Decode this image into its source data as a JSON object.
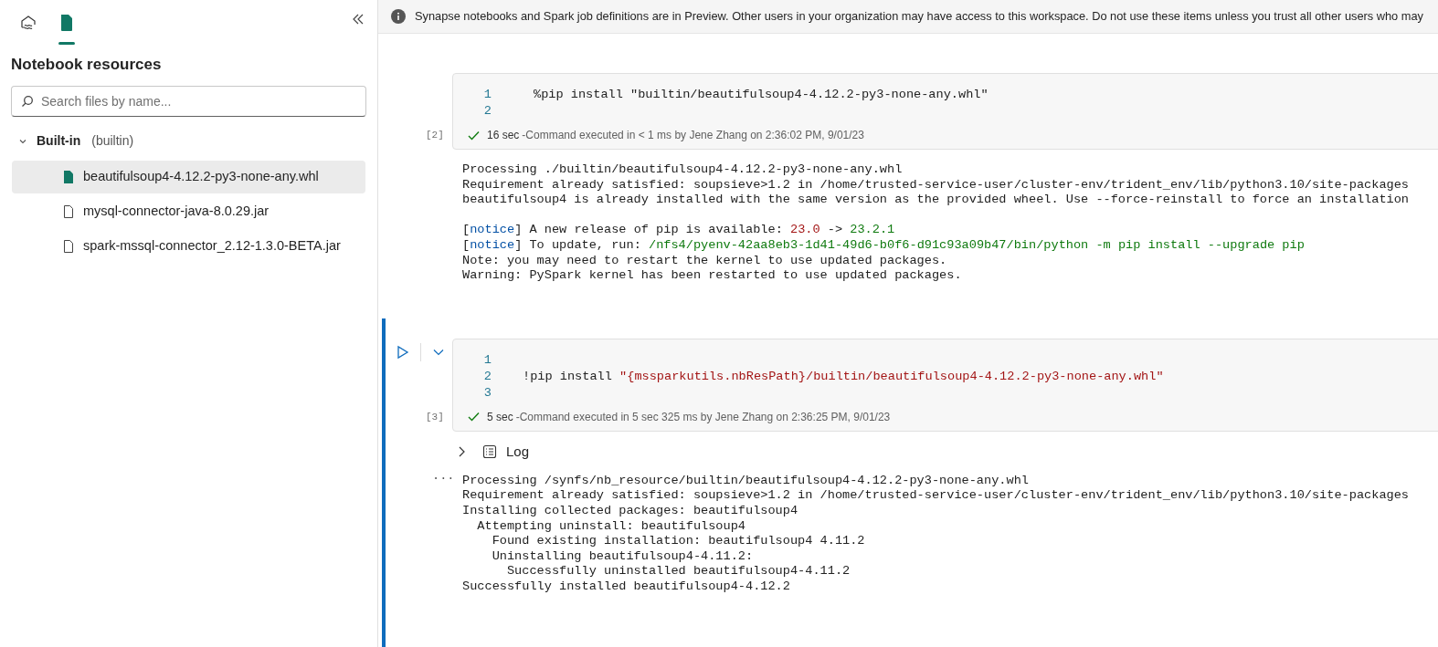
{
  "sidebar": {
    "tabs": [
      {
        "kind": "lakehouse",
        "selected": false
      },
      {
        "kind": "resources",
        "selected": true
      }
    ],
    "title": "Notebook resources",
    "search": {
      "placeholder": "Search files by name..."
    },
    "tree": [
      {
        "label": "Built-in",
        "sublabel": "(builtin)",
        "expanded": true,
        "children": [
          {
            "label": "beautifulsoup4-4.12.2-py3-none-any.whl",
            "selected": true
          },
          {
            "label": "mysql-connector-java-8.0.29.jar",
            "selected": false
          },
          {
            "label": "spark-mssql-connector_2.12-1.3.0-BETA.jar",
            "selected": false
          }
        ]
      }
    ]
  },
  "banner": {
    "text": "Synapse notebooks and Spark job definitions are in Preview. Other users in your organization may have access to this workspace. Do not use these items unless you trust all other users who may"
  },
  "cells": [
    {
      "active": false,
      "execution_count": "[2]",
      "lines": [
        {
          "number": "1",
          "segments": [
            {
              "text": "%pip install \"builtin/beautifulsoup4-4.12.2-py3-none-any.whl\"",
              "kind": "plain"
            }
          ]
        },
        {
          "number": "2"
        }
      ],
      "status": {
        "duration": "16 sec",
        "message": "-Command executed in < 1 ms by Jene Zhang on 2:36:02 PM, 9/01/23"
      },
      "output": [
        {
          "lines": [
            [
              {
                "text": "Processing ./builtin/beautifulsoup4-4.12.2-py3-none-any.whl",
                "kind": "plain"
              }
            ],
            [
              {
                "text": "Requirement already satisfied: soupsieve>1.2 in /home/trusted-service-user/cluster-env/trident_env/lib/python3.10/site-packages",
                "kind": "plain"
              }
            ],
            [
              {
                "text": "beautifulsoup4 is already installed with the same version as the provided wheel. Use --force-reinstall to force an installation",
                "kind": "plain"
              }
            ]
          ]
        },
        {
          "lines": [
            [
              {
                "text": "[",
                "kind": "plain"
              },
              {
                "text": "notice",
                "kind": "keyword"
              },
              {
                "text": "] A new release of pip is available: ",
                "kind": "plain"
              },
              {
                "text": "23.0",
                "kind": "old"
              },
              {
                "text": " -> ",
                "kind": "plain"
              },
              {
                "text": "23.2.1",
                "kind": "new"
              }
            ],
            [
              {
                "text": "[",
                "kind": "plain"
              },
              {
                "text": "notice",
                "kind": "keyword"
              },
              {
                "text": "] To update, run: ",
                "kind": "plain"
              },
              {
                "text": "/nfs4/pyenv-42aa8eb3-1d41-49d6-b0f6-d91c93a09b47/bin/python -m pip install --upgrade pip",
                "kind": "new"
              }
            ],
            [
              {
                "text": "Note: you may need to restart the kernel to use updated packages.",
                "kind": "plain"
              }
            ],
            [
              {
                "text": "Warning: PySpark kernel has been restarted to use updated packages.",
                "kind": "plain"
              }
            ]
          ]
        }
      ]
    },
    {
      "active": true,
      "execution_count": "[3]",
      "lines": [
        {
          "number": "1"
        },
        {
          "number": "2",
          "segments": [
            {
              "text": "!pip install ",
              "kind": "plain"
            },
            {
              "text": "\"{mssparkutils.nbResPath}/builtin/beautifulsoup4-4.12.2-py3-none-any.whl\"",
              "kind": "string"
            }
          ]
        },
        {
          "number": "3"
        }
      ],
      "status": {
        "duration": "5 sec",
        "message": "-Command executed in 5 sec 325 ms by Jene Zhang on 2:36:25 PM, 9/01/23"
      },
      "log": {
        "label": "Log",
        "expanded": false
      },
      "output_menu": "···",
      "output": [
        {
          "lines": [
            [
              {
                "text": "Processing /synfs/nb_resource/builtin/beautifulsoup4-4.12.2-py3-none-any.whl",
                "kind": "plain"
              }
            ],
            [
              {
                "text": "Requirement already satisfied: soupsieve>1.2 in /home/trusted-service-user/cluster-env/trident_env/lib/python3.10/site-packages",
                "kind": "plain"
              }
            ],
            [
              {
                "text": "Installing collected packages: beautifulsoup4",
                "kind": "plain"
              }
            ],
            [
              {
                "text": "  Attempting uninstall: beautifulsoup4",
                "kind": "plain"
              }
            ],
            [
              {
                "text": "    Found existing installation: beautifulsoup4 4.11.2",
                "kind": "plain"
              }
            ],
            [
              {
                "text": "    Uninstalling beautifulsoup4-4.11.2:",
                "kind": "plain"
              }
            ],
            [
              {
                "text": "      Successfully uninstalled beautifulsoup4-4.11.2",
                "kind": "plain"
              }
            ],
            [
              {
                "text": "Successfully installed beautifulsoup4-4.12.2",
                "kind": "plain"
              }
            ]
          ]
        }
      ]
    }
  ]
}
